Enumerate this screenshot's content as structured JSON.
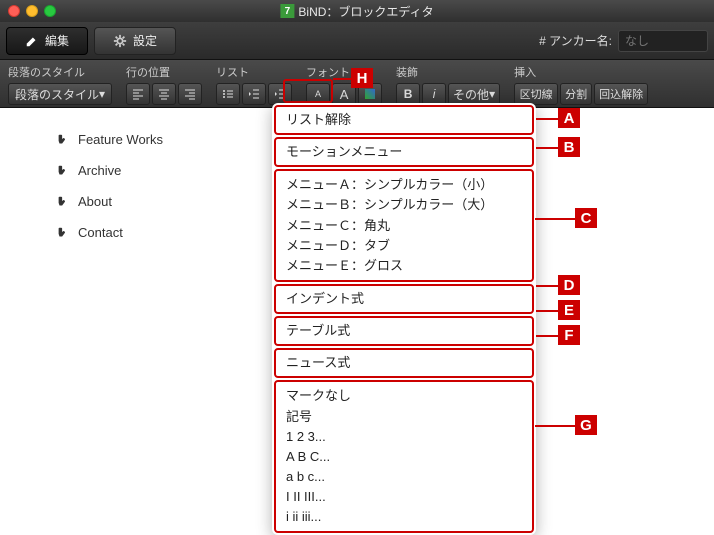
{
  "window": {
    "title": "BiND：ブロックエディタ",
    "appIconText": "7"
  },
  "tabs": {
    "edit": "編集",
    "settings": "設定"
  },
  "anchor": {
    "label": "# アンカー名:",
    "placeholder": "なし"
  },
  "toolbar": {
    "paraStyle": {
      "label": "段落のスタイル",
      "button": "段落のスタイル"
    },
    "linePos": {
      "label": "行の位置"
    },
    "list": {
      "label": "リスト"
    },
    "font": {
      "label": "フォント"
    },
    "deco": {
      "label": "装飾"
    },
    "misc": {
      "other": "その他"
    },
    "insert": {
      "label": "挿入",
      "b1": "区切線",
      "b2": "分割",
      "b3": "回込解除"
    }
  },
  "sidebar": {
    "items": [
      "Feature Works",
      "Archive",
      "About",
      "Contact"
    ]
  },
  "dropdown": {
    "g1": [
      "リスト解除"
    ],
    "g2": [
      "モーションメニュー"
    ],
    "g3": [
      "メニューＡ：シンプルカラー（小）",
      "メニューＢ：シンプルカラー（大）",
      "メニューＣ：角丸",
      "メニューＤ：タブ",
      "メニューＥ：グロス"
    ],
    "g4": [
      "インデント式"
    ],
    "g5": [
      "テーブル式"
    ],
    "g6": [
      "ニュース式"
    ],
    "g7": [
      "マークなし",
      "記号",
      "1 2 3...",
      "A B C...",
      "a b c...",
      "I II III...",
      "i ii iii..."
    ]
  },
  "callouts": {
    "A": "A",
    "B": "B",
    "C": "C",
    "D": "D",
    "E": "E",
    "F": "F",
    "G": "G",
    "H": "H"
  }
}
